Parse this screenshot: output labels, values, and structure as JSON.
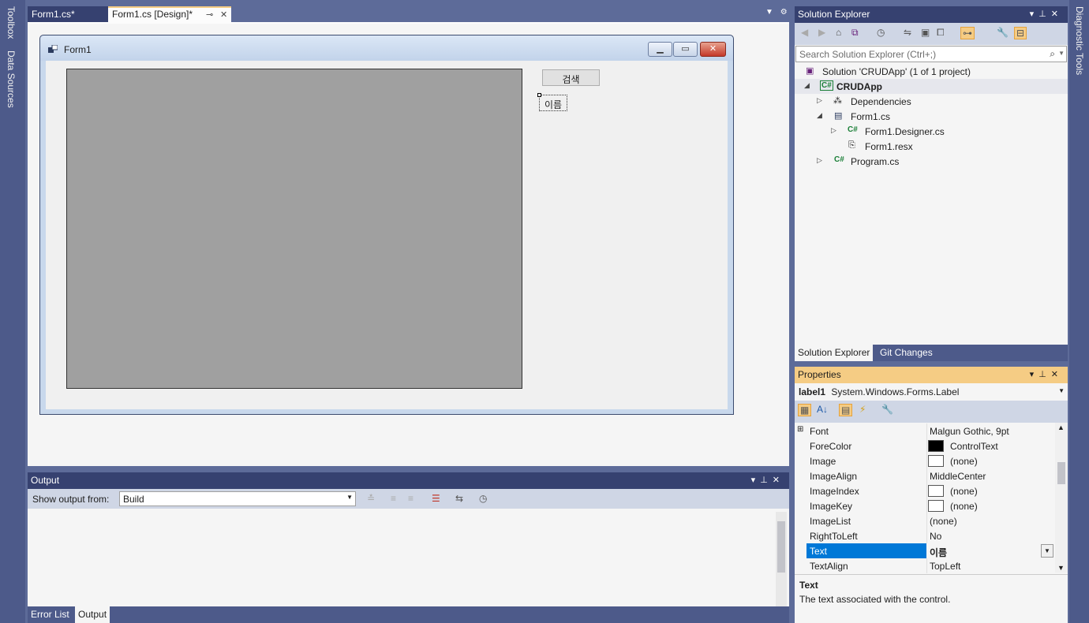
{
  "left_rail": {
    "tabs": [
      "Toolbox",
      "Data Sources"
    ]
  },
  "right_rail": {
    "tabs": [
      "Diagnostic Tools"
    ]
  },
  "doc_tabs": [
    {
      "label": "Form1.cs*",
      "active": false
    },
    {
      "label": "Form1.cs [Design]*",
      "active": true
    }
  ],
  "designer": {
    "form_title": "Form1",
    "search_button": "검색",
    "name_label": "이름"
  },
  "output": {
    "title": "Output",
    "show_from_label": "Show output from:",
    "source_value": "Build"
  },
  "bottom_tabs": [
    "Error List",
    "Output"
  ],
  "solution_explorer": {
    "title": "Solution Explorer",
    "search_placeholder": "Search Solution Explorer (Ctrl+;)",
    "tree": [
      {
        "label": "Solution 'CRUDApp'   (1 of 1 project)",
        "icon": "solution-icon"
      },
      {
        "label": "CRUDApp",
        "icon": "csharp-project-icon"
      },
      {
        "label": "Dependencies",
        "icon": "dependencies-icon"
      },
      {
        "label": "Form1.cs",
        "icon": "form-icon"
      },
      {
        "label": "Form1.Designer.cs",
        "icon": "csharp-file-icon"
      },
      {
        "label": "Form1.resx",
        "icon": "resource-file-icon"
      },
      {
        "label": "Program.cs",
        "icon": "csharp-file-icon"
      }
    ],
    "tabs": [
      "Solution Explorer",
      "Git Changes"
    ]
  },
  "properties": {
    "title": "Properties",
    "object_name": "label1",
    "object_type": "System.Windows.Forms.Label",
    "rows": [
      {
        "name": "Font",
        "value": "Malgun Gothic, 9pt"
      },
      {
        "name": "ForeColor",
        "value": "ControlText",
        "swatch": "#000000"
      },
      {
        "name": "Image",
        "value": "(none)",
        "swatch": "#ffffff"
      },
      {
        "name": "ImageAlign",
        "value": "MiddleCenter"
      },
      {
        "name": "ImageIndex",
        "value": "(none)",
        "swatch": "#ffffff"
      },
      {
        "name": "ImageKey",
        "value": "(none)",
        "swatch": "#ffffff"
      },
      {
        "name": "ImageList",
        "value": "(none)"
      },
      {
        "name": "RightToLeft",
        "value": "No"
      },
      {
        "name": "Text",
        "value": "이름"
      },
      {
        "name": "TextAlign",
        "value": "TopLeft"
      }
    ],
    "description_title": "Text",
    "description_text": "The text associated with the control."
  },
  "colors": {
    "frame": "#5d6b99",
    "tab_active_accent": "#f5cc84",
    "selection": "#0078d7"
  }
}
